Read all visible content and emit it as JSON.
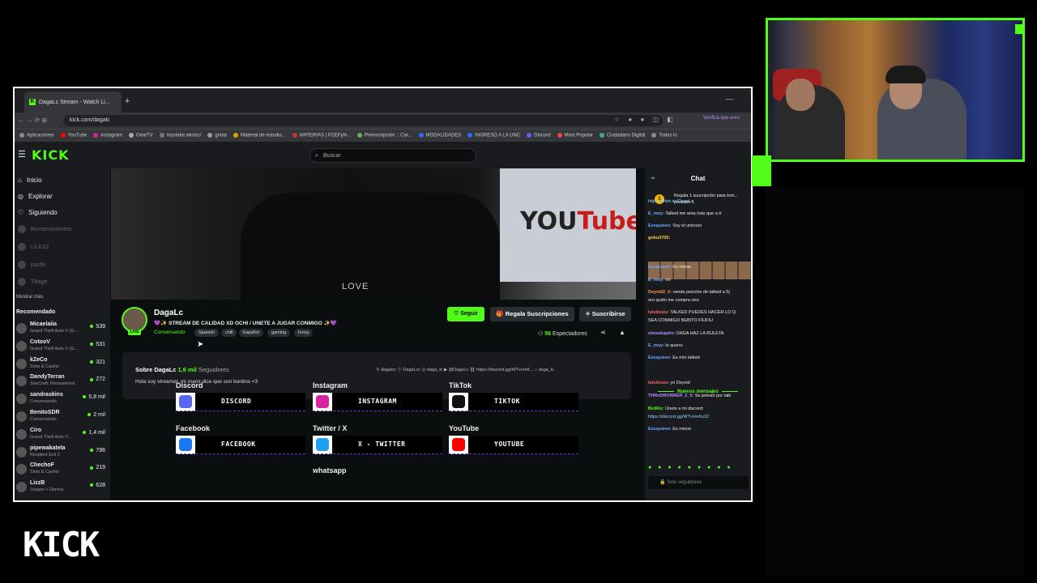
{
  "browser": {
    "tab_title": "DagaLc Stream - Watch Li...",
    "url": "kick.com/dagalc",
    "verify_text": "Verifica que eres",
    "bookmarks": [
      "Aplicaciones",
      "YouTube",
      "Instagram",
      "OmeTV",
      "mystake.win/as/",
      "gnula",
      "Material de estudio...",
      "MATERIAS | FCEFyN...",
      "Preinscripción :: Car...",
      "MODALIDADES",
      "INGRESO A LA UNC",
      "Discord",
      "Most Popular",
      "Ciudadano Digital",
      "Todos lo"
    ]
  },
  "kick": {
    "logo": "KICK",
    "search_placeholder": "Buscar",
    "nav": [
      {
        "label": "Inicio",
        "icon": "home-icon"
      },
      {
        "label": "Explorar",
        "icon": "compass-icon"
      },
      {
        "label": "Siguiendo",
        "icon": "heart-icon"
      }
    ],
    "offline_following": [
      "Romerosromero",
      "LILK22",
      "paolfx",
      "Tillage"
    ],
    "mostrar_mas": "Mostrar más",
    "recomendado_label": "Recomendado",
    "recommended": [
      {
        "name": "Micaelaiia",
        "game": "Grand Theft Auto V (G...",
        "viewers": "539"
      },
      {
        "name": "CotooV",
        "game": "Grand Theft Auto V (G...",
        "viewers": "531"
      },
      {
        "name": "kZeCo",
        "game": "Slots & Casino",
        "viewers": "321"
      },
      {
        "name": "DandyTerran",
        "game": "StarCraft: Remastered",
        "viewers": "272"
      },
      {
        "name": "sandraskins",
        "game": "Conversando",
        "viewers": "5,8 mil"
      },
      {
        "name": "BenitoSDR",
        "game": "Conversando",
        "viewers": "2 mil"
      },
      {
        "name": "Ciro",
        "game": "Grand Theft Auto V...",
        "viewers": "1,4 mil"
      },
      {
        "name": "pipewakatela",
        "game": "Resident Evil 2",
        "viewers": "796"
      },
      {
        "name": "ChechoF",
        "game": "Slots & Casino",
        "viewers": "219"
      },
      {
        "name": "LizzB",
        "game": "Juegos + Demos",
        "viewers": "628"
      }
    ]
  },
  "video": {
    "board_text_you": "YOU",
    "board_text_tube": "Tube",
    "shirt_text": "LOVE"
  },
  "channel": {
    "name": "DagaLc",
    "title": "💜✨ STREAM DE CALIDAD XD OCHI / UNETE  A JUGAR CONMIGO ✨💜",
    "category": "Conversando",
    "live": "LIVE",
    "tags": [
      "Spanish",
      "chill",
      "Español",
      "gaming",
      "funny"
    ],
    "follow_btn": "♡ Seguir",
    "gift_btn": "Regala Suscripciones",
    "sub_btn": "Suscribirse",
    "viewers_count": "56",
    "viewers_label": "Espectadores",
    "about_prefix": "Sobre DagaLc",
    "followers_count": "1,6 mil",
    "followers_label": "Seguidores",
    "bio": "Hola soy streamer, mi mami dice que son bonitos <3",
    "socials": "𝕏 dagalcc   ⓕ DagaLcc   ◎ daga_lc   ▶ @DagaLc   ⛓ https://discord.gg/WTvvreK...   ♪ daga_lc"
  },
  "panels": [
    {
      "title": "Discord",
      "label": "DISCORD",
      "color": "#5865f2"
    },
    {
      "title": "Instagram",
      "label": "INSTAGRAM",
      "color": "#d6249f"
    },
    {
      "title": "TikTok",
      "label": "TIKTOK",
      "color": "#111111"
    },
    {
      "title": "Facebook",
      "label": "FACEBOOK",
      "color": "#1877f2"
    },
    {
      "title": "Twitter / X",
      "label": "X - TWITTER",
      "color": "#1da1f2"
    },
    {
      "title": "YouTube",
      "label": "YOUTUBE",
      "color": "#ff0000"
    },
    {
      "title": "whatsapp"
    }
  ],
  "chat": {
    "title": "Chat",
    "gift_banner": "Regala 1 suscripción para tom... posición 1",
    "gift_rank": "1",
    "messages": [
      {
        "user": "",
        "text": "https://linktr.ee/DagaLc",
        "color": "#8fd3ff"
      },
      {
        "user": "E_moy:",
        "text": " Talked me ama más que a ti",
        "color": "#6fa8ff"
      },
      {
        "user": "Ezequieee:",
        "text": " Soy el unicooo",
        "color": "#6fa8ff"
      },
      {
        "user": "goku3705:",
        "text": "",
        "color": "#ffd24a"
      },
      {
        "user": "Ezequieee:",
        "text": " Es miooo",
        "color": "#6fa8ff"
      },
      {
        "user": "E_moy:",
        "text": " no",
        "color": "#6fa8ff"
      },
      {
        "user": "Deyvid2_0:",
        "text": " vendo peluche de talked a 5(",
        "color": "#ff9a4a"
      },
      {
        "user": "",
        "text": "oro quién me compra uno",
        "color": "#eee"
      },
      {
        "user": "luisitosiu:",
        "text": " TALKED PUEDES HACER LO Q",
        "color": "#ff6b6b"
      },
      {
        "user": "",
        "text": "SEA CONMIGO BEBITO FIUFIU",
        "color": "#eee"
      },
      {
        "user": "elmazkapito:",
        "text": " DAGA HAZ LA RULETA",
        "color": "#b48cff"
      },
      {
        "user": "E_moy:",
        "text": " lo quiero",
        "color": "#6fa8ff"
      },
      {
        "user": "Ezequieee:",
        "text": " Es mío talked",
        "color": "#6fa8ff"
      },
      {
        "user": "luisitosiu:",
        "text": " yo Deyvid",
        "color": "#ff6b6b"
      },
      {
        "user": "THRxDRONNER_2_0:",
        "text": " Se pelean por talk",
        "color": "#b48cff"
      },
      {
        "user": "BotRix:",
        "text": " Únete a mi discord:",
        "color": "#53fc18"
      },
      {
        "user": "",
        "text": "https://discord.gg/WTvvreKu32",
        "color": "#8fd3ff"
      },
      {
        "user": "Ezequieee:",
        "text": " Es miooo",
        "color": "#6fa8ff"
      }
    ],
    "new_messages": "Nuevos mensajes",
    "input_placeholder": "Solo seguidores"
  },
  "overlay_logo": "KICK",
  "colors": {
    "accent": "#53fc18",
    "panel": "#191b1f",
    "background": "#0b0e0f"
  }
}
